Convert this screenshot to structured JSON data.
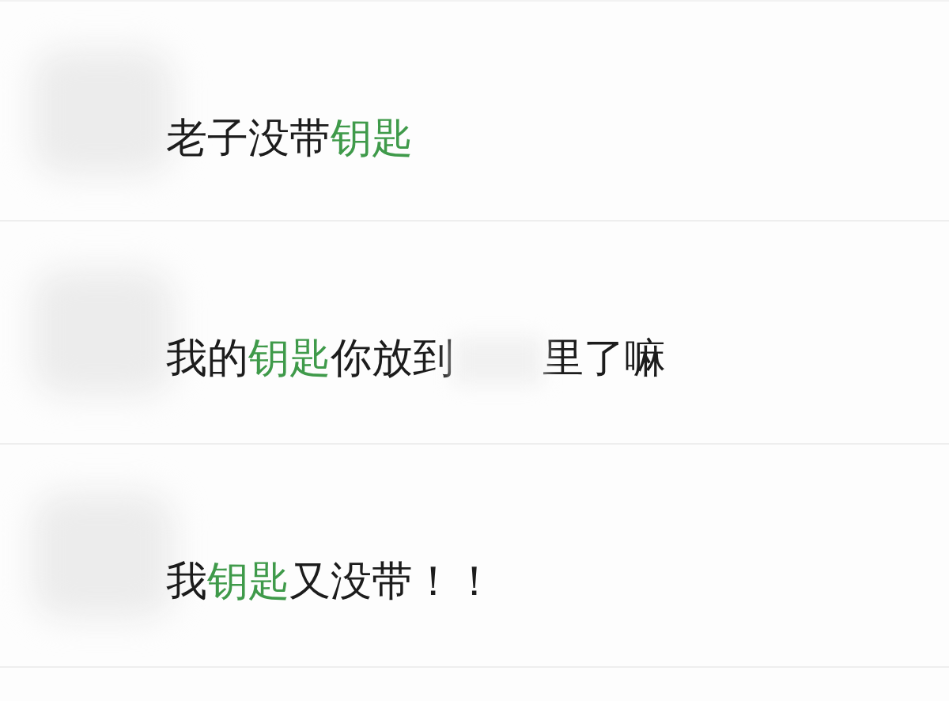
{
  "messages": [
    {
      "segments": [
        {
          "kind": "text",
          "text": "老子没带",
          "highlight": false
        },
        {
          "kind": "text",
          "text": "钥匙",
          "highlight": true
        }
      ]
    },
    {
      "segments": [
        {
          "kind": "text",
          "text": "我的",
          "highlight": false
        },
        {
          "kind": "text",
          "text": "钥匙",
          "highlight": true
        },
        {
          "kind": "text",
          "text": "你放到",
          "highlight": false
        },
        {
          "kind": "redacted"
        },
        {
          "kind": "text",
          "text": "里了嘛",
          "highlight": false
        }
      ]
    },
    {
      "segments": [
        {
          "kind": "text",
          "text": "我",
          "highlight": false
        },
        {
          "kind": "text",
          "text": "钥匙",
          "highlight": true
        },
        {
          "kind": "text",
          "text": "又没带！！",
          "highlight": false
        }
      ]
    }
  ]
}
